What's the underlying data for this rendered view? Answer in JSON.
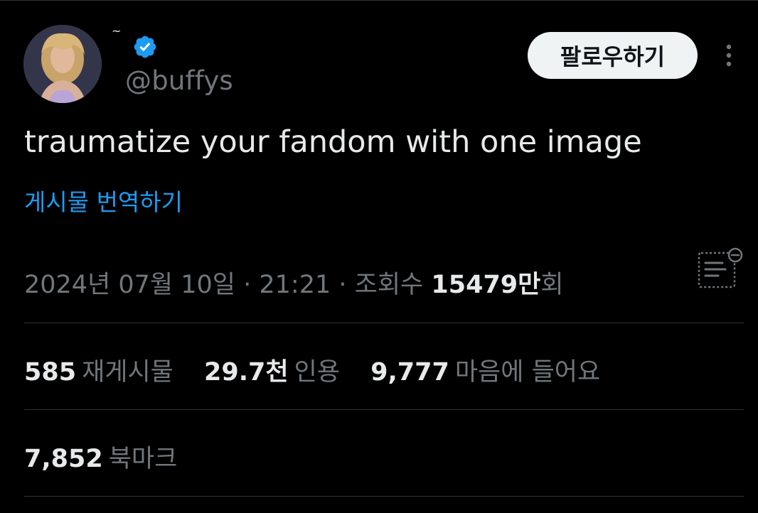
{
  "author": {
    "display_name": "~",
    "handle": "@buffys",
    "verified": true
  },
  "actions": {
    "follow_label": "팔로우하기"
  },
  "tweet": {
    "text": "traumatize your fandom with one image",
    "translate_label": "게시물 번역하기"
  },
  "meta": {
    "date": "2024년 07월 10일",
    "sep1": " · ",
    "time": "21:21",
    "sep2": " · ",
    "views_label": "조회수 ",
    "views_count": "15479만",
    "views_suffix": "회"
  },
  "stats": {
    "reposts_count": "585",
    "reposts_label": "재게시물",
    "quotes_count": "29.7천",
    "quotes_label": "인용",
    "likes_count": "9,777",
    "likes_label": "마음에 들어요",
    "bookmarks_count": "7,852",
    "bookmarks_label": "북마크"
  },
  "colors": {
    "background": "#000000",
    "text_primary": "#e7e9ea",
    "text_secondary": "#71767b",
    "accent_blue": "#1d9bf0",
    "divider": "#2f3336",
    "follow_button_bg": "#eff3f4"
  },
  "icons": {
    "verified": "verified-badge-icon",
    "more": "more-options-icon",
    "analytics": "analytics-icon"
  }
}
